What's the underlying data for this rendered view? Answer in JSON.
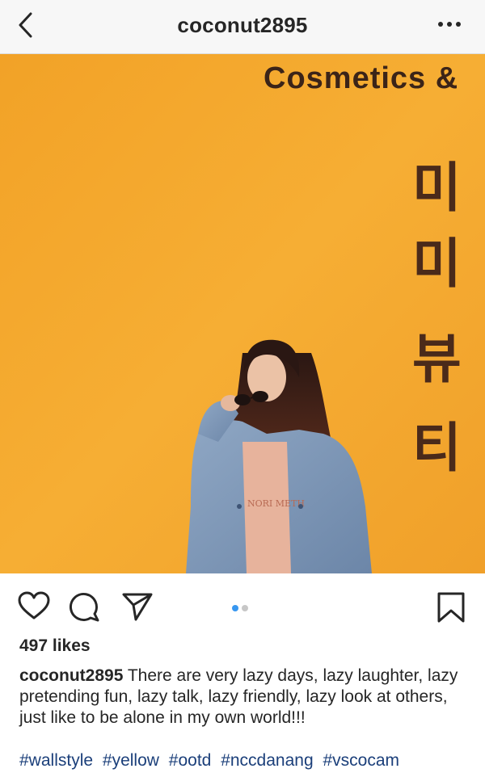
{
  "header": {
    "title": "coconut2895",
    "back_icon": "chevron-left-icon",
    "more_icon": "ellipsis-icon"
  },
  "photo": {
    "sign_text": "Cosmetics &",
    "korean_chars": [
      "미",
      "미",
      "뷰",
      "티"
    ],
    "shirt_text": "NORI METH",
    "wall_color": "#f4aa2c"
  },
  "actions": {
    "like_icon": "heart-icon",
    "comment_icon": "comment-icon",
    "share_icon": "send-icon",
    "save_icon": "bookmark-icon",
    "carousel": {
      "count": 2,
      "active": 0,
      "active_color": "#3897f0",
      "inactive_color": "#c7c7c7"
    }
  },
  "post": {
    "likes": "497 likes",
    "username": "coconut2895",
    "caption": "There are very lazy days, lazy laughter, lazy pretending fun, lazy talk, lazy friendly, lazy look at others, just like to be alone in my own world!!!",
    "hashtags": [
      "#wallstyle",
      "#yellow",
      "#ootd",
      "#nccdanang",
      "#vscocam"
    ],
    "hashtag_color": "#1b3f7a"
  }
}
